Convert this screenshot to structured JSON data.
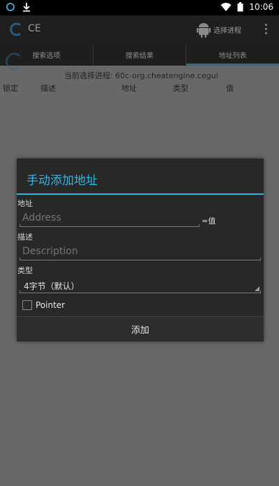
{
  "status_bar": {
    "time": "10:06"
  },
  "app": {
    "title": "CE",
    "process_button": "选择进程"
  },
  "tabs": [
    {
      "label": "搜索选项"
    },
    {
      "label": "搜索结果"
    },
    {
      "label": "地址列表"
    }
  ],
  "current_process": "当前选择进程: 60c-org.cheatengine.cegui",
  "columns": [
    "锁定",
    "描述",
    "地址",
    "类型",
    "值"
  ],
  "dialog": {
    "title": "手动添加地址",
    "address_label": "地址",
    "address_placeholder": "Address",
    "equals_value_label": "=值",
    "description_label": "描述",
    "description_placeholder": "Description",
    "type_label": "类型",
    "type_value": "4字节（默认）",
    "pointer_label": "Pointer",
    "add_button": "添加"
  },
  "colors": {
    "accent": "#33b5e5",
    "dialog_bg": "#282828",
    "dim_bg": "#686868"
  }
}
